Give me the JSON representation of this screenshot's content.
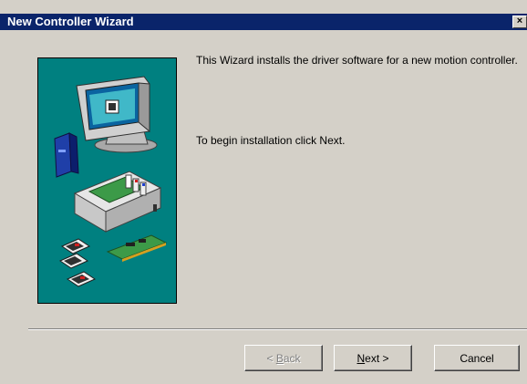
{
  "window": {
    "title": "New Controller Wizard",
    "close_glyph": "×"
  },
  "body": {
    "intro_text": "This Wizard installs the driver software for a new motion controller.",
    "begin_text": "To begin installation click Next."
  },
  "buttons": {
    "back": {
      "prefix": "< ",
      "mnemonic": "B",
      "rest": "ack",
      "enabled": false
    },
    "next": {
      "mnemonic": "N",
      "rest": "ext >",
      "enabled": true
    },
    "cancel": {
      "label": "Cancel",
      "enabled": true
    }
  },
  "colors": {
    "title_bar": "#0a246a",
    "picture_background": "#008080",
    "dialog_background": "#d4d0c8"
  },
  "icons": [
    "monitor-icon",
    "disk-drive-icon",
    "computer-case-icon",
    "controller-card-icon"
  ]
}
